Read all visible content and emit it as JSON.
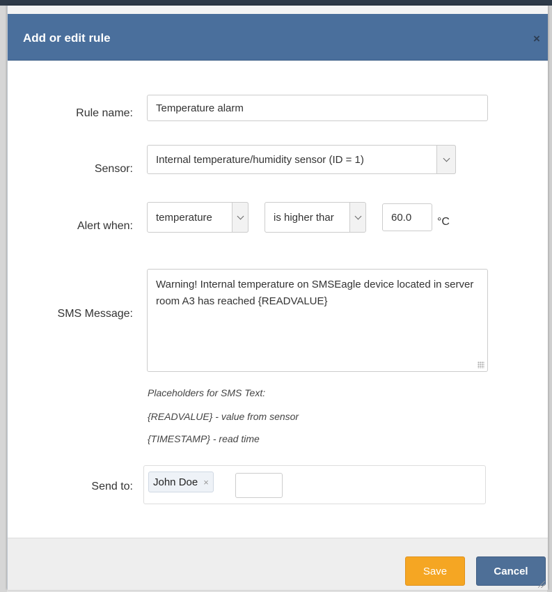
{
  "modal": {
    "title": "Add or edit rule",
    "close_symbol": "×"
  },
  "form": {
    "rule_name": {
      "label": "Rule name:",
      "value": "Temperature alarm"
    },
    "sensor": {
      "label": "Sensor:",
      "value": "Internal temperature/humidity sensor (ID = 1)"
    },
    "alert_when": {
      "label": "Alert when:",
      "parameter": "temperature",
      "condition": "is higher thar",
      "threshold": "60.0",
      "unit": "°C"
    },
    "sms_message": {
      "label": "SMS Message:",
      "value": "Warning! Internal temperature on SMSEagle device located in server room A3 has reached {READVALUE}"
    },
    "placeholders": {
      "title": "Placeholders for SMS Text:",
      "items": [
        "{READVALUE} - value from sensor",
        "{TIMESTAMP} - read time"
      ]
    },
    "send_to": {
      "label": "Send to:",
      "recipients": [
        "John Doe"
      ],
      "remove_symbol": "×"
    }
  },
  "footer": {
    "save_label": "Save",
    "cancel_label": "Cancel"
  },
  "icons": [
    "close-icon",
    "chevron-down-icon",
    "remove-tag-icon",
    "resize-grip-icon"
  ],
  "colors": {
    "header": "#4a6f9c",
    "save": "#f5a623",
    "cancel": "#4e6f97"
  }
}
